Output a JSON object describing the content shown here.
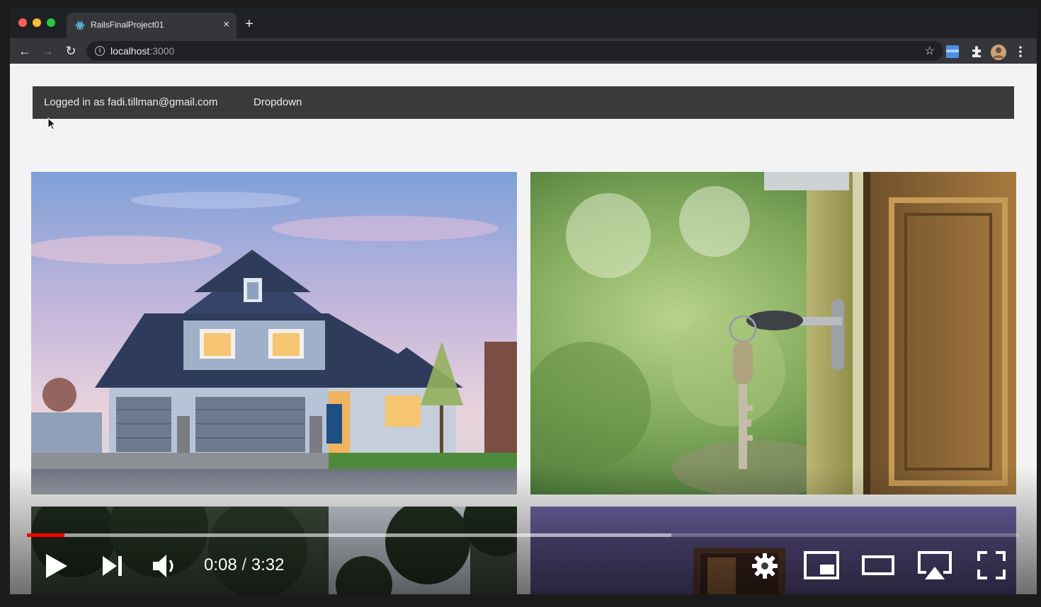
{
  "browser": {
    "tab_title": "RailsFinalProject01",
    "tab_close": "×",
    "new_tab": "+",
    "url_host": "localhost",
    "url_port": ":3000",
    "back": "←",
    "forward": "→",
    "reload": "↻",
    "star": "☆"
  },
  "navbar": {
    "logged_in_text": "Logged in as fadi.tillman@gmail.com",
    "dropdown_label": "Dropdown"
  },
  "images": [
    {
      "name": "house-photo"
    },
    {
      "name": "key-in-door-photo"
    },
    {
      "name": "trees-photo"
    },
    {
      "name": "interior-photo"
    }
  ],
  "player": {
    "current_time": "0:08",
    "separator": " / ",
    "duration": "3:32",
    "played_fraction": 0.038,
    "loaded_fraction": 0.65,
    "colors": {
      "played": "#ff0000"
    }
  }
}
